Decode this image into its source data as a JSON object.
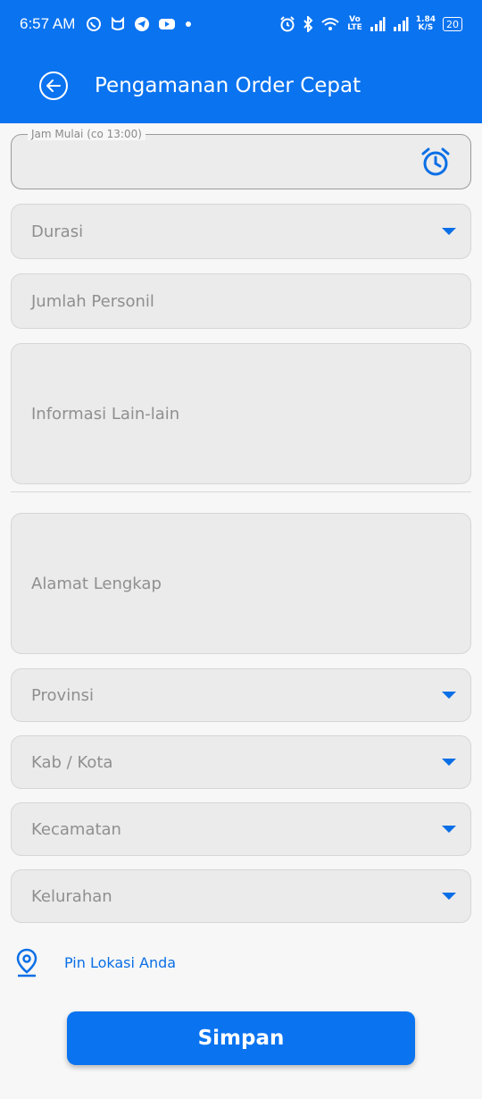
{
  "status_bar": {
    "time": "6:57 AM",
    "network_speed_top": "1.84",
    "network_speed_bottom": "K/S",
    "volte_top": "Vo",
    "volte_bottom": "LTE",
    "battery": "20",
    "icons": [
      "whatsapp-icon",
      "cat-icon",
      "telegram-icon",
      "youtube-icon",
      "dot-icon",
      "alarm-icon",
      "bluetooth-icon",
      "wifi-icon",
      "signal-icon",
      "signal-icon",
      "battery-icon"
    ]
  },
  "app_bar": {
    "title": "Pengamanan Order Cepat",
    "back_icon": "back-arrow-icon"
  },
  "form": {
    "jam_mulai": {
      "label": "Jam Mulai (co 13:00)",
      "value": "",
      "icon": "alarm-clock-icon"
    },
    "durasi": {
      "placeholder": "Durasi"
    },
    "jumlah_personil": {
      "placeholder": "Jumlah Personil"
    },
    "informasi": {
      "placeholder": "Informasi Lain-lain"
    },
    "alamat": {
      "placeholder": "Alamat Lengkap"
    },
    "provinsi": {
      "placeholder": "Provinsi"
    },
    "kab_kota": {
      "placeholder": "Kab / Kota"
    },
    "kecamatan": {
      "placeholder": "Kecamatan"
    },
    "kelurahan": {
      "placeholder": "Kelurahan"
    }
  },
  "pin_location": {
    "label": "Pin Lokasi Anda",
    "icon": "map-pin-icon"
  },
  "save_button": {
    "label": "Simpan"
  },
  "colors": {
    "primary": "#0a73f0",
    "field_bg": "#ebebeb",
    "page_bg": "#f7f7f7"
  }
}
